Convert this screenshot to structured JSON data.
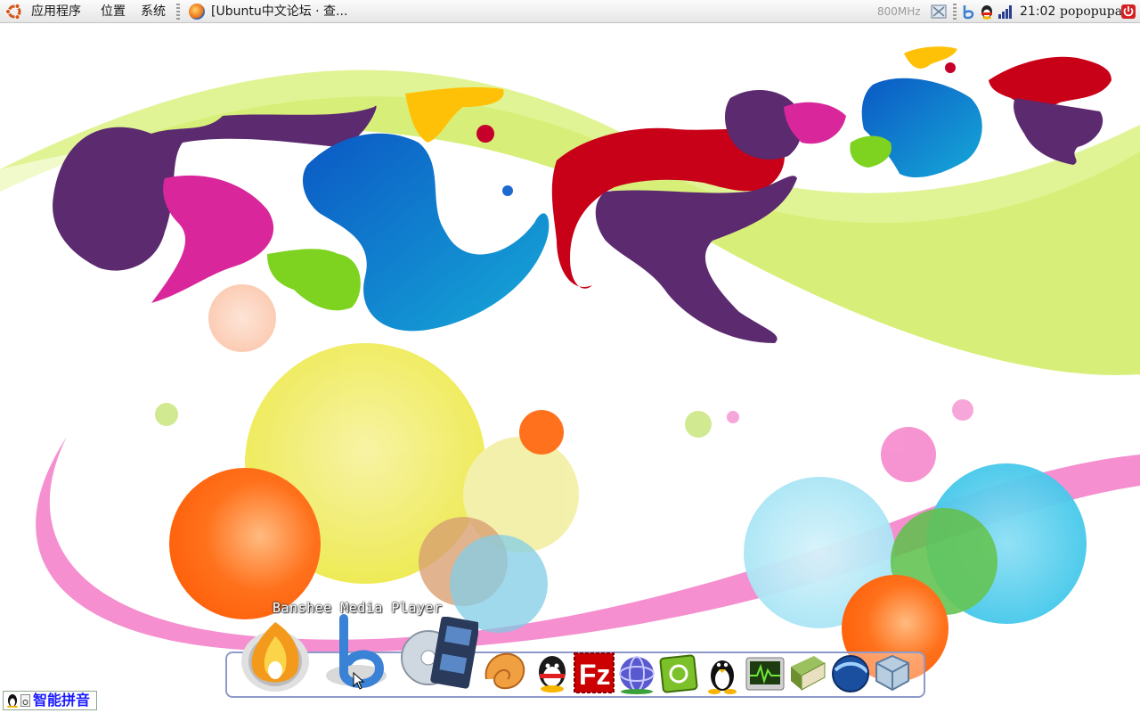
{
  "top_panel": {
    "menus": [
      "应用程序",
      "位置",
      "系统"
    ],
    "task_title": "[Ubuntu中文论坛 · 查...",
    "cpu_freq": "800MHz",
    "clock": "21:02",
    "username": "popopupa"
  },
  "dock": {
    "hover_label": "Banshee Media Player",
    "icons": [
      "firefox-icon",
      "banshee-icon",
      "video-player-icon",
      "nautilus-icon",
      "qq-icon",
      "filezilla-icon",
      "pidgin-icon",
      "ubuntu-tweak-icon",
      "tux-icon",
      "system-monitor-icon",
      "stardict-icon",
      "google-earth-icon",
      "virtualbox-icon"
    ]
  },
  "ime": {
    "label": "智能拼音"
  },
  "colors": {
    "panel_bg": "#ececec",
    "dock_border": "#8e9ac9",
    "ime_text": "#1a1aff"
  }
}
